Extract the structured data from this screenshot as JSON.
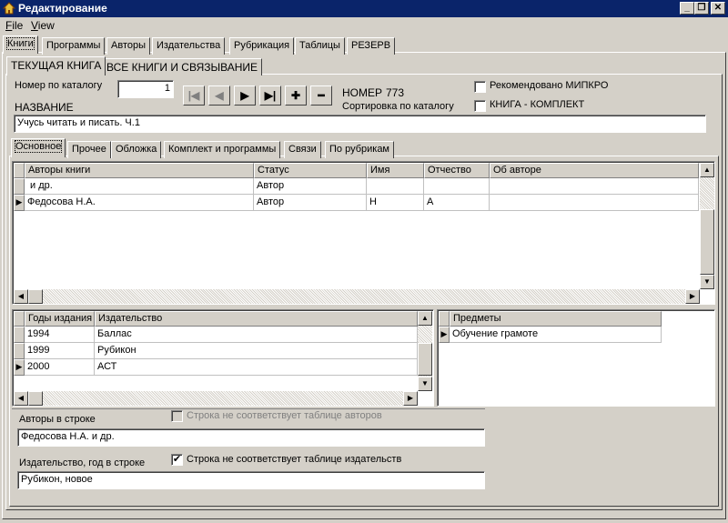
{
  "window": {
    "title": "Редактирование",
    "controls": {
      "minimize": "_",
      "maximize": "❐",
      "close": "✕"
    }
  },
  "menu": [
    {
      "label": "File",
      "hotkey": "F",
      "rest": "ile"
    },
    {
      "label": "View",
      "hotkey": "V",
      "rest": "iew"
    }
  ],
  "main_tabs": [
    "Книги",
    "Программы",
    "Авторы",
    "Издательства",
    "Рубрикация",
    "Таблицы",
    "РЕЗЕРВ"
  ],
  "sub_tabs": [
    "ТЕКУЩАЯ КНИГА",
    "ВСЕ КНИГИ И СВЯЗЫВАНИЕ"
  ],
  "book": {
    "catalog_label": "Номер по каталогу",
    "catalog_value": "1",
    "number_label": "НОМЕР",
    "number_value": "773",
    "sort_label": "Сортировка по каталогу",
    "recommended_label": "Рекомендовано МИПКРО",
    "recommended_checked": false,
    "kit_label": "КНИГА - КОМПЛЕКТ",
    "kit_checked": false,
    "name_label": "НАЗВАНИЕ",
    "name_value": "Учусь читать и писать. Ч.1"
  },
  "nav_buttons": {
    "first": "|◀",
    "prev": "◀",
    "next": "▶",
    "last": "▶|",
    "add": "✚",
    "remove": "━"
  },
  "detail_tabs": [
    "Основное",
    "Прочее",
    "Обложка",
    "Комплект и программы",
    "Связи",
    "По рубрикам"
  ],
  "authors_grid": {
    "columns": [
      "Авторы книги",
      "Статус",
      "Имя",
      "Отчество",
      "Об авторе"
    ],
    "rows": [
      [
        "и др.",
        "Автор",
        "",
        "",
        ""
      ],
      [
        "Федосова Н.А.",
        "Автор",
        "Н",
        "А",
        ""
      ]
    ],
    "current_row": 1
  },
  "editions_grid": {
    "columns": [
      "Годы издания",
      "Издательство"
    ],
    "rows": [
      [
        "1994",
        "Баллас"
      ],
      [
        "1999",
        "Рубикон"
      ],
      [
        "2000",
        "АСТ"
      ]
    ],
    "current_row": 2
  },
  "subjects_grid": {
    "columns": [
      "Предметы"
    ],
    "rows": [
      [
        "Обучение грамоте"
      ]
    ],
    "current_row": 0
  },
  "bottom": {
    "authors_line_label": "Авторы в строке",
    "authors_mismatch_label": "Строка не соответствует таблице авторов",
    "authors_mismatch_checked": false,
    "authors_line_value": "Федосова Н.А. и др.",
    "publisher_line_label": "Издательство, год в строке",
    "publisher_mismatch_label": "Строка не соответствует таблице издательств",
    "publisher_mismatch_checked": true,
    "publisher_line_value": "Рубикон, новое"
  },
  "icons": {
    "current_row_indicator": "▶",
    "check_mark": "✔"
  },
  "colors": {
    "title_bar": "#0a246a",
    "face": "#d4d0c8",
    "window": "#ffffff"
  }
}
